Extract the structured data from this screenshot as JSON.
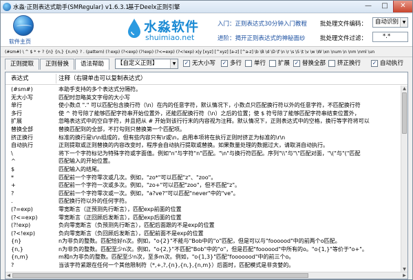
{
  "window": {
    "title": "水淼·正则表达式助手(SMRegular) v1.6.3.1",
    "subtitle": "基于Deelx正则引擎",
    "min_glyph": "—",
    "max_glyph": "□",
    "close_glyph": "✕"
  },
  "header": {
    "home_link": "软件主页",
    "logo_cn": "水淼软件",
    "logo_en": "shuimiao.net",
    "link_intro": "入门：正则表达式30分钟入门教程",
    "link_advanced": "进阶：揭开正则表达式的神秘面纱",
    "encoding_label": "批处理文件编码：",
    "encoding_value": "自动识别",
    "filter_label": "批处理文件过滤：",
    "filter_value": "*.*"
  },
  "symbols_bar": "(#sm#)  \\  ^  $  *  +  ?  {n}  {n,}  {n,m}  ?  .  (pattern)  (?:exp)  (?<exp)  (?!exp)  (?<=exp)  (?<!exp)  x|y  [xyz]  [^xyz]  [a-z]  [^a-z]  \\b  \\B  \\d  \\D  \\f  \\n  \\r  \\s  \\S  \\t  \\v  \\w  \\W  \\xn  \\num  \\n  \\nm  \\nml  \\un",
  "toolbar": {
    "tabs": [
      "正则提取",
      "正则替换",
      "语法帮助"
    ],
    "active_tab": 2,
    "select_value": "【自定义正则】",
    "checkboxes": [
      {
        "label": "无大小写",
        "checked": true
      },
      {
        "label": "多行",
        "checked": true
      },
      {
        "label": "单行",
        "checked": false
      },
      {
        "label": "扩展",
        "checked": false
      },
      {
        "label": "替换全部",
        "checked": true
      },
      {
        "label": "挤正换行",
        "checked": false
      },
      {
        "label": "自动执行",
        "checked": true
      }
    ]
  },
  "help_table": {
    "col1_header": "表达式",
    "col2_header": "注释（右键单击可以复制表达式）",
    "rows": [
      {
        "expr": "(#sm#)",
        "note": "本助手支持的多个表达式分隔符。"
      },
      {
        "expr": "无大小写",
        "note": "匹配时忽略英文字母的大小写"
      },
      {
        "expr": "单行",
        "note": "使小数点 \".\" 可以匹配包含换行符（\\n）在内的任意字符，默认情况下，小数点只匹配换行符以外的任意字符，不匹配换行符"
      },
      {
        "expr": "多行",
        "note": "使 ^ 符号除了能够匹配字符串开始位置外，还能匹配换行符（\\n）之后的位置；使 $ 符号除了能够匹配字符串结束位置外，"
      },
      {
        "expr": "扩展",
        "note": "忽略表达式中的空白字符，并且把从 # 开始到该行行末的内容视为注释。默认情况下，正则表达式中的空格，换行等字符将可以"
      },
      {
        "expr": "替换全部",
        "note": "替换匹配到的全部，不打勾则只替换第一个匹配项。"
      },
      {
        "expr": "挤正换行",
        "note": "标准的换行是\\r\\n组成的，但有些内容只有\\r或\\n，启用本项将在执行正则时挤正为标准的\\r\\n"
      },
      {
        "expr": "自动执行",
        "note": "正则提取或正则替换的内容改变时，程序会自动执行提取或替换。如果数量处理的数据过大，请取消自动执行。"
      },
      {
        "expr": "\\",
        "note": "将下一个字符标记为特殊字符或字面值。例如\"n\"与字符\"n\"匹配。\"\\n\"与换行符匹配。序列\"\\\\\"与\"\\\"匹配对面，\"\\(\"与\"(\"匹配"
      },
      {
        "expr": "^",
        "note": "匹配输入的开始位置。"
      },
      {
        "expr": "$",
        "note": "匹配输入的结尾。"
      },
      {
        "expr": "*",
        "note": "匹配前一个字符零次或几次。例如，\"zo*\"可以匹配\"z\"、\"zoo\"。"
      },
      {
        "expr": "+",
        "note": "匹配前一个字符一次或多次。例如，\"zo+\"可以匹配\"zoo\"，但不匹配\"z\"。"
      },
      {
        "expr": "?",
        "note": "匹配前一个字符零次或一次。例如，\"a?ve?\"可以匹配\"never\"中的\"ve\"。"
      },
      {
        "expr": ".",
        "note": "匹配换行符以外的任何字符。"
      },
      {
        "expr": "(?=exp)",
        "note": "零宽断言（正预测先行断言），匹配exp前面的位置"
      },
      {
        "expr": "(?<=exp)",
        "note": "零宽断言（正回顾后发断言），匹配exp后面的位置"
      },
      {
        "expr": "(?!exp)",
        "note": "负向零宽断言（负预测先行断言），匹配后面跟的不是exp的位置"
      },
      {
        "expr": "(?<!exp)",
        "note": "负向零宽断言（负回顾后发断言），匹配前面不是exp的位置"
      },
      {
        "expr": "{n}",
        "note": "n为非负的整数。匹配恰好n次。例如，\"o{2}\"不能与\"Bob中的\"o\"匹配，但是可以与\"foooood\"中的前两个o匹配。"
      },
      {
        "expr": "{n,}",
        "note": "n为非负的整数。匹配至少n次。例如，\"o{2,}\"不匹配\"Bob\"中的\"o\"，但是匹配\"foooood\"中所有的o。\"o{1,}\"等价于\"o+\"。"
      },
      {
        "expr": "{n,m}",
        "note": "m和n为非负的整数。匹配至少n次，至多m次。例如，\"o{1,3}\"匹配\"fooooood\"中的前三个o。"
      },
      {
        "expr": "?",
        "note": "当该字符紧跟在任何一个其他限制符（*,+,?,{n},{n,},{n,m}）后面时，匹配模式是非贪婪的。"
      }
    ]
  }
}
